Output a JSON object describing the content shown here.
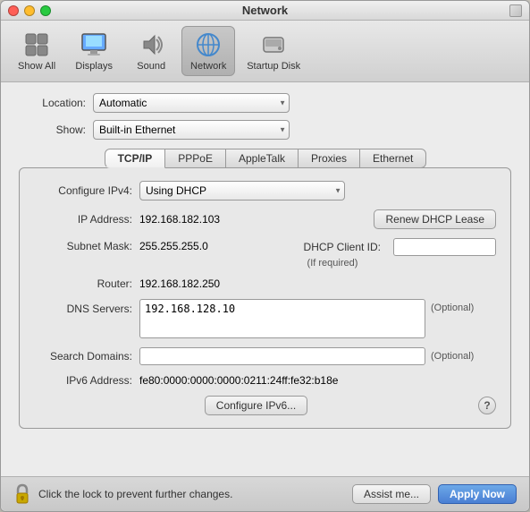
{
  "window": {
    "title": "Network"
  },
  "toolbar": {
    "items": [
      {
        "id": "show-all",
        "label": "Show All",
        "icon": "⌂"
      },
      {
        "id": "displays",
        "label": "Displays",
        "icon": "🖥"
      },
      {
        "id": "sound",
        "label": "Sound",
        "icon": "🔊"
      },
      {
        "id": "network",
        "label": "Network",
        "icon": "🌐",
        "active": true
      },
      {
        "id": "startup-disk",
        "label": "Startup Disk",
        "icon": "💿"
      }
    ]
  },
  "location_label": "Location:",
  "location_value": "Automatic",
  "show_label": "Show:",
  "show_value": "Built-in Ethernet",
  "tabs": [
    {
      "id": "tcpip",
      "label": "TCP/IP",
      "active": true
    },
    {
      "id": "pppoe",
      "label": "PPPoE"
    },
    {
      "id": "appletalk",
      "label": "AppleTalk"
    },
    {
      "id": "proxies",
      "label": "Proxies"
    },
    {
      "id": "ethernet",
      "label": "Ethernet"
    }
  ],
  "panel": {
    "configure_label": "Configure IPv4:",
    "configure_value": "Using DHCP",
    "ip_label": "IP Address:",
    "ip_value": "192.168.182.103",
    "renew_btn": "Renew DHCP Lease",
    "subnet_label": "Subnet Mask:",
    "subnet_value": "255.255.255.0",
    "dhcp_client_label": "DHCP Client ID:",
    "dhcp_client_placeholder": "",
    "if_required": "(If required)",
    "router_label": "Router:",
    "router_value": "192.168.182.250",
    "dns_label": "DNS Servers:",
    "dns_value": "192.168.128.10",
    "dns_optional": "(Optional)",
    "search_label": "Search Domains:",
    "search_optional": "(Optional)",
    "ipv6_label": "IPv6 Address:",
    "ipv6_value": "fe80:0000:0000:0000:0211:24ff:fe32:b18e",
    "configure_ipv6_btn": "Configure IPv6...",
    "help_btn": "?"
  },
  "bottom": {
    "lock_text": "Click the lock to prevent further changes.",
    "assist_btn": "Assist me...",
    "apply_btn": "Apply Now"
  }
}
